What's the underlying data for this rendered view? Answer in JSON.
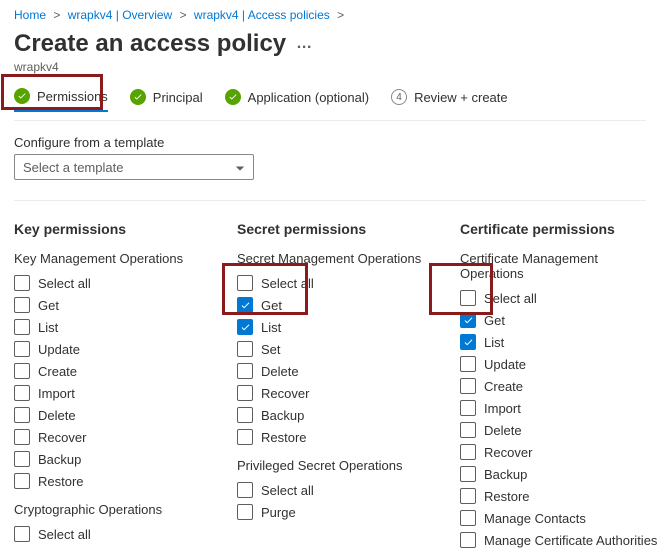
{
  "breadcrumb": {
    "home": "Home",
    "overview": "wrapkv4 | Overview",
    "access_policies": "wrapkv4 | Access policies"
  },
  "page": {
    "title": "Create an access policy",
    "subtitle": "wrapkv4",
    "ellipsis": "…"
  },
  "wizard": {
    "step1": {
      "label": "Permissions"
    },
    "step2": {
      "label": "Principal"
    },
    "step3": {
      "label": "Application (optional)"
    },
    "step4": {
      "num": "4",
      "label": "Review + create"
    }
  },
  "template": {
    "label": "Configure from a template",
    "placeholder": "Select a template"
  },
  "key_perms": {
    "title": "Key permissions",
    "mgmt_title": "Key Management Operations",
    "select_all": "Select all",
    "items": [
      "Get",
      "List",
      "Update",
      "Create",
      "Import",
      "Delete",
      "Recover",
      "Backup",
      "Restore"
    ],
    "crypto_title": "Cryptographic Operations",
    "crypto_select_all": "Select all"
  },
  "secret_perms": {
    "title": "Secret permissions",
    "mgmt_title": "Secret Management Operations",
    "select_all": "Select all",
    "items": [
      "Get",
      "List",
      "Set",
      "Delete",
      "Recover",
      "Backup",
      "Restore"
    ],
    "checked": [
      "Get",
      "List"
    ],
    "priv_title": "Privileged Secret Operations",
    "priv_select_all": "Select all",
    "priv_items": [
      "Purge"
    ]
  },
  "cert_perms": {
    "title": "Certificate permissions",
    "mgmt_title": "Certificate Management Operations",
    "select_all": "Select all",
    "items": [
      "Get",
      "List",
      "Update",
      "Create",
      "Import",
      "Delete",
      "Recover",
      "Backup",
      "Restore",
      "Manage Contacts",
      "Manage Certificate Authorities"
    ],
    "checked": [
      "Get",
      "List"
    ]
  }
}
